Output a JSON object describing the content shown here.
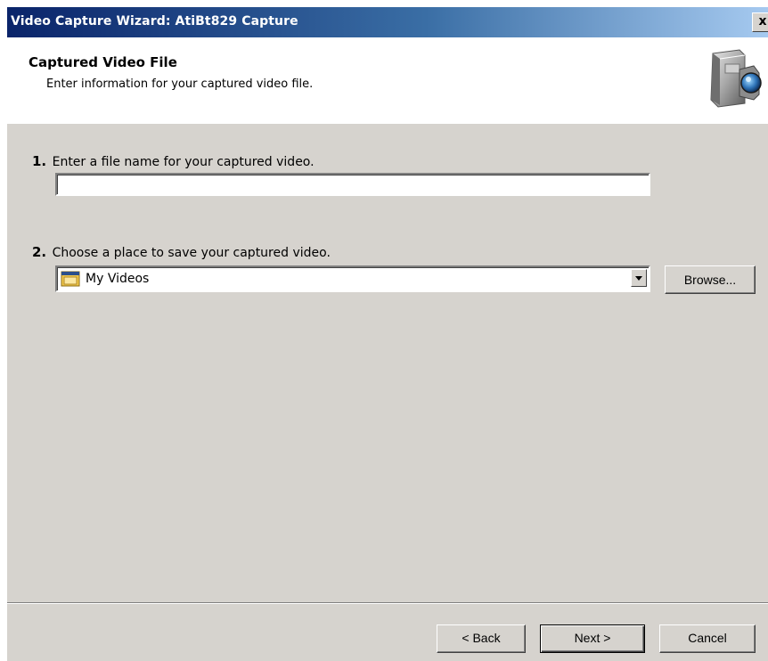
{
  "window": {
    "title": "Video Capture Wizard: AtiBt829 Capture",
    "close_label": "x",
    "titlebar_color": "#0a246a"
  },
  "header": {
    "title": "Captured Video File",
    "subtitle": "Enter information for your captured video file.",
    "icon": "video-camera-icon"
  },
  "step1": {
    "number": "1.",
    "label": "Enter a file name for your captured video.",
    "value": ""
  },
  "step2": {
    "number": "2.",
    "label": "Choose a place to save your captured video.",
    "selected_location": "My Videos",
    "location_icon": "folder-icon",
    "browse_label": "Browse..."
  },
  "footer": {
    "back_label": "< Back",
    "next_label": "Next >",
    "cancel_label": "Cancel"
  }
}
